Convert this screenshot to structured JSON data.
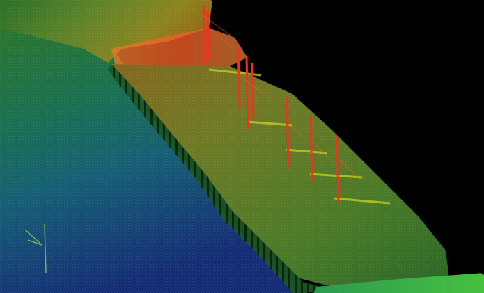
{
  "scene": {
    "content": "lidar-point-cloud-elevation-render",
    "background_color": "#000000",
    "colormap": [
      "#1a3fb0",
      "#1f7fc8",
      "#22b0a8",
      "#2cc05a",
      "#7fd030",
      "#d8d820",
      "#f08020",
      "#ff2020"
    ],
    "labels_visible": false
  }
}
